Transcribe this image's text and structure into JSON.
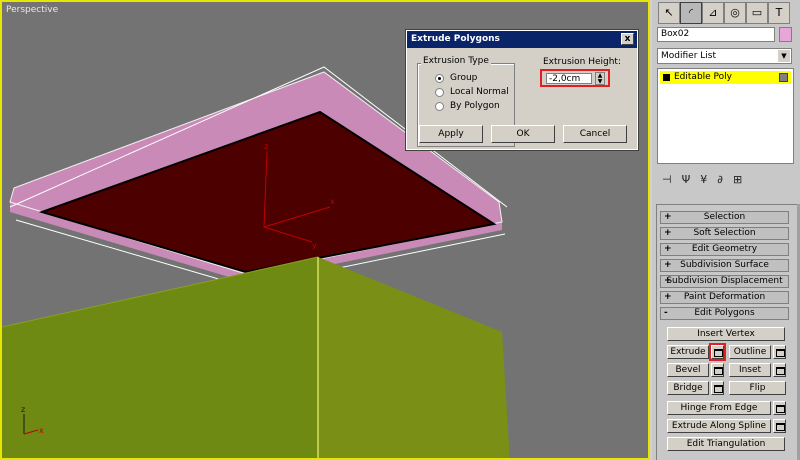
{
  "viewport": {
    "label": "Perspective",
    "gizmo": {
      "z": "z",
      "x": "x",
      "y": "y"
    },
    "axis_tripod": {
      "z": "z",
      "x": "x"
    }
  },
  "dialog": {
    "title": "Extrude Polygons",
    "close": "x",
    "group_title": "Extrusion Type",
    "options": [
      "Group",
      "Local Normal",
      "By Polygon"
    ],
    "selected": "Group",
    "height_label": "Extrusion Height:",
    "height_value": "-2,0cm",
    "apply": "Apply",
    "ok": "OK",
    "cancel": "Cancel"
  },
  "panel": {
    "object_name": "Box02",
    "modifier_list": "Modifier List",
    "stack_item": "Editable Poly",
    "rollouts": [
      {
        "pm": "+",
        "label": "Selection"
      },
      {
        "pm": "+",
        "label": "Soft Selection"
      },
      {
        "pm": "+",
        "label": "Edit Geometry"
      },
      {
        "pm": "+",
        "label": "Subdivision Surface"
      },
      {
        "pm": "+",
        "label": "Subdivision Displacement"
      },
      {
        "pm": "+",
        "label": "Paint Deformation"
      },
      {
        "pm": "-",
        "label": "Edit Polygons"
      }
    ],
    "buttons": {
      "insert_vertex": "Insert Vertex",
      "extrude": "Extrude",
      "outline": "Outline",
      "bevel": "Bevel",
      "inset": "Inset",
      "bridge": "Bridge",
      "flip": "Flip",
      "hinge": "Hinge From Edge",
      "extrude_spline": "Extrude Along Spline",
      "edit_tri": "Edit Triangulation"
    }
  },
  "colors": {
    "viewport_bg": "#737373",
    "active_border": "#e6e600",
    "lid_top": "#4d0000",
    "lid_side": "#c98ab8",
    "box": "#7a8f16",
    "highlight": "#e02020"
  }
}
